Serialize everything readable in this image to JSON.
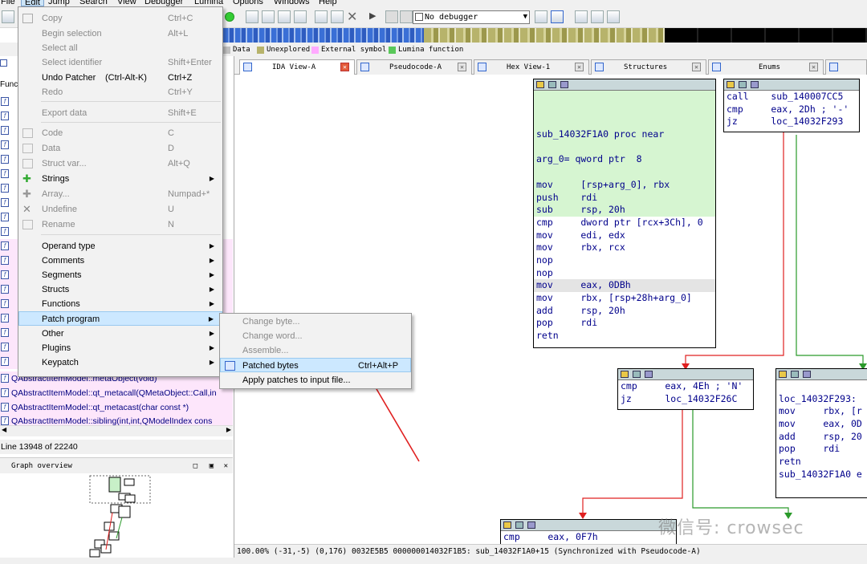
{
  "menubar": {
    "items": [
      "File",
      "Edit",
      "Jump",
      "Search",
      "View",
      "Debugger",
      "Lumina",
      "Options",
      "Windows",
      "Help"
    ]
  },
  "toolbar": {
    "debugger": "No debugger"
  },
  "legend": [
    {
      "label": "Data",
      "color": "#c0c0c0"
    },
    {
      "label": "Unexplored",
      "color": "#b7b36b"
    },
    {
      "label": "External symbol",
      "color": "#ffaaff"
    },
    {
      "label": "Lumina function",
      "color": "#5ac85a"
    }
  ],
  "tabs": [
    {
      "label": "IDA View-A",
      "active": true
    },
    {
      "label": "Pseudocode-A",
      "active": false
    },
    {
      "label": "Hex View-1",
      "active": false
    },
    {
      "label": "Structures",
      "active": false
    },
    {
      "label": "Enums",
      "active": false
    }
  ],
  "edit_menu": {
    "items": [
      {
        "label": "Copy",
        "shortcut": "Ctrl+C",
        "disabled": true
      },
      {
        "label": "Begin selection",
        "shortcut": "Alt+L",
        "disabled": true
      },
      {
        "label": "Select all",
        "shortcut": "",
        "disabled": true
      },
      {
        "label": "Select identifier",
        "shortcut": "Shift+Enter",
        "disabled": true
      },
      {
        "label": "Undo Patcher",
        "extra": "(Ctrl-Alt-K)",
        "shortcut": "Ctrl+Z",
        "disabled": false
      },
      {
        "label": "Redo",
        "shortcut": "Ctrl+Y",
        "disabled": true
      },
      {
        "label": "Export data",
        "shortcut": "Shift+E",
        "disabled": true
      },
      {
        "label": "Code",
        "shortcut": "C",
        "disabled": true
      },
      {
        "label": "Data",
        "shortcut": "D",
        "disabled": true
      },
      {
        "label": "Struct var...",
        "shortcut": "Alt+Q",
        "disabled": true
      },
      {
        "label": "Strings",
        "shortcut": "",
        "disabled": false
      },
      {
        "label": "Array...",
        "shortcut": "Numpad+*",
        "disabled": true
      },
      {
        "label": "Undefine",
        "shortcut": "U",
        "disabled": true
      },
      {
        "label": "Rename",
        "shortcut": "N",
        "disabled": true
      },
      {
        "label": "Operand type",
        "shortcut": "",
        "disabled": false
      },
      {
        "label": "Comments",
        "shortcut": "",
        "disabled": false
      },
      {
        "label": "Segments",
        "shortcut": "",
        "disabled": false
      },
      {
        "label": "Structs",
        "shortcut": "",
        "disabled": false
      },
      {
        "label": "Functions",
        "shortcut": "",
        "disabled": false
      },
      {
        "label": "Patch program",
        "shortcut": "",
        "disabled": false
      },
      {
        "label": "Other",
        "shortcut": "",
        "disabled": false
      },
      {
        "label": "Plugins",
        "shortcut": "",
        "disabled": false
      },
      {
        "label": "Keypatch",
        "shortcut": "",
        "disabled": false
      }
    ]
  },
  "patch_submenu": {
    "items": [
      {
        "label": "Change byte...",
        "shortcut": "",
        "disabled": true
      },
      {
        "label": "Change word...",
        "shortcut": "",
        "disabled": true
      },
      {
        "label": "Assemble...",
        "shortcut": "",
        "disabled": true
      },
      {
        "label": "Patched bytes",
        "shortcut": "Ctrl+Alt+P",
        "disabled": false
      },
      {
        "label": "Apply patches to input file...",
        "shortcut": "",
        "disabled": false
      }
    ]
  },
  "functions": {
    "header": "Functi",
    "visible_names": [
      "QAbstractItemModel::metaObject(void)",
      "QAbstractItemModel::qt_metacall(QMetaObject::Call,in",
      "QAbstractItemModel::qt_metacast(char const *)",
      "QAbstractItemModel::sibling(int,int,QModelIndex cons"
    ],
    "line_count": "Line 13948 of 22240"
  },
  "graph_overview": {
    "title": "Graph overview"
  },
  "graph": {
    "main_block": {
      "lines": [
        "",
        "",
        "",
        "sub_14032F1A0 proc near",
        "",
        "arg_0= qword ptr  8",
        "",
        "mov     [rsp+arg_0], rbx",
        "push    rdi",
        "sub     rsp, 20h",
        "cmp     dword ptr [rcx+3Ch], 0",
        "mov     edi, edx",
        "mov     rbx, rcx",
        "nop",
        "nop",
        "mov     eax, 0DBh",
        "mov     rbx, [rsp+28h+arg_0]",
        "add     rsp, 20h",
        "pop     rdi",
        "retn"
      ]
    },
    "right_top_block": {
      "lines": [
        "call    sub_140007CC5",
        "cmp     eax, 2Dh ; '-'",
        "jz      loc_14032F293"
      ]
    },
    "mid_block": {
      "lines": [
        "cmp     eax, 4Eh ; 'N'",
        "jz      loc_14032F26C"
      ]
    },
    "right_block": {
      "lines": [
        "",
        "loc_14032F293:",
        "mov     rbx, [r",
        "mov     eax, 0D",
        "add     rsp, 20",
        "pop     rdi",
        "retn",
        "sub_14032F1A0 e"
      ]
    },
    "bottom_block": {
      "lines": [
        "cmp     eax, 0F7h"
      ]
    }
  },
  "status_bar": "100.00% (-31,-5) (0,176) 0032E5B5 000000014032F1B5: sub_14032F1A0+15 (Synchronized with Pseudocode-A)",
  "watermark": "微信号: crowsec"
}
